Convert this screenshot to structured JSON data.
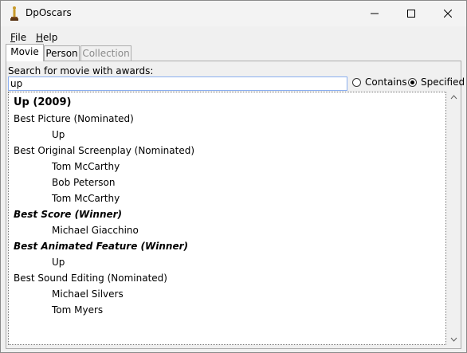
{
  "window": {
    "title": "DpOscars"
  },
  "menu": {
    "file_prefix": "F",
    "file_rest": "ile",
    "help_prefix": "H",
    "help_rest": "elp"
  },
  "tabs": [
    {
      "label": "Movie",
      "state": "active"
    },
    {
      "label": "Person",
      "state": "normal"
    },
    {
      "label": "Collection",
      "state": "disabled"
    }
  ],
  "search": {
    "label": "Search for movie with awards:",
    "value": "up"
  },
  "mode": {
    "contains_label": "Contains",
    "specified_label": "Specified",
    "selected": "Specified"
  },
  "results": {
    "movie_heading": "Up (2009)",
    "lines": [
      {
        "text": "Best Picture (Nominated)",
        "kind": "award"
      },
      {
        "text": "Up",
        "kind": "person"
      },
      {
        "text": "Best Original Screenplay (Nominated)",
        "kind": "award"
      },
      {
        "text": "Tom McCarthy",
        "kind": "person"
      },
      {
        "text": "Bob Peterson",
        "kind": "person"
      },
      {
        "text": "Tom McCarthy",
        "kind": "person"
      },
      {
        "text": "Best Score (Winner)",
        "kind": "winner"
      },
      {
        "text": "Michael Giacchino",
        "kind": "person"
      },
      {
        "text": "Best Animated Feature (Winner)",
        "kind": "winner"
      },
      {
        "text": "Up",
        "kind": "person"
      },
      {
        "text": "Best Sound Editing (Nominated)",
        "kind": "award"
      },
      {
        "text": "Michael Silvers",
        "kind": "person"
      },
      {
        "text": "Tom Myers",
        "kind": "person"
      }
    ]
  }
}
